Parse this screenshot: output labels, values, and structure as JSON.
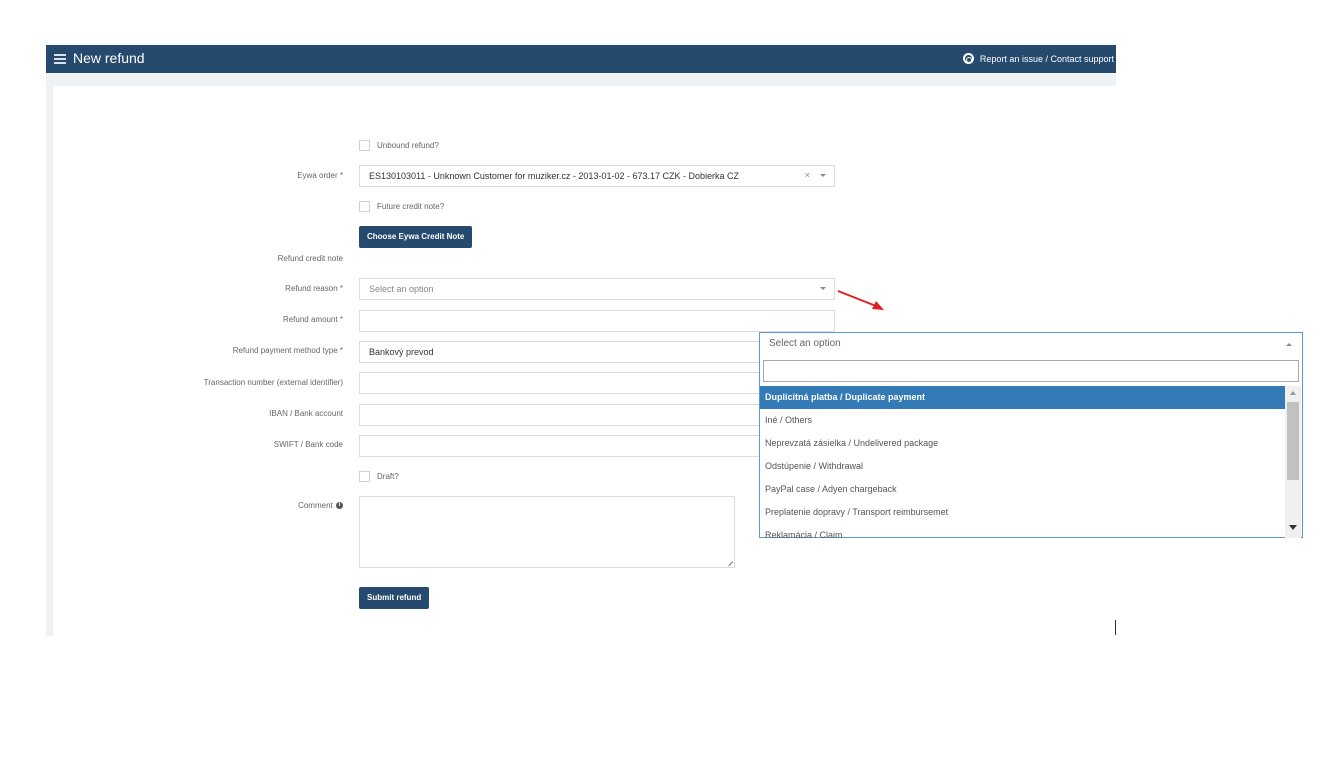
{
  "header": {
    "title": "New refund",
    "support_label": "Report an issue / Contact support"
  },
  "form": {
    "unbound_label": "Unbound refund?",
    "order_label": "Eywa order *",
    "order_value": "ES130103011 - Unknown Customer for muziker.cz - 2013-01-02 - 673.17 CZK - Dobierka CZ",
    "order_clear": "×",
    "future_credit_label": "Future credit note?",
    "choose_credit_button": "Choose Eywa Credit Note",
    "refund_credit_note_label": "Refund credit note",
    "reason_label": "Refund reason *",
    "reason_placeholder": "Select an option",
    "amount_label": "Refund amount *",
    "amount_value": "",
    "payment_method_label": "Refund payment method type *",
    "payment_method_value": "Bankový prevod",
    "transaction_label": "Transaction number (external identifier)",
    "transaction_value": "",
    "iban_label": "IBAN / Bank account",
    "iban_value": "",
    "swift_label": "SWIFT / Bank code",
    "swift_value": "",
    "draft_label": "Draft?",
    "comment_label": "Comment",
    "comment_value": "",
    "submit_button": "Submit refund"
  },
  "dropdown": {
    "selected_text": "Select an option",
    "search_value": "",
    "options": [
      "Duplicitná platba / Duplicate payment",
      "Iné / Others",
      "Neprevzatá zásielka / Undelivered package",
      "Odstúpenie / Withdrawal",
      "PayPal case / Adyen chargeback",
      "Preplatenie dopravy / Transport reimbursemet",
      "Reklamácia / Claim"
    ],
    "highlighted_index": 0
  },
  "colors": {
    "header_bg": "#254a6d",
    "button_bg": "#254a6d",
    "highlight": "#337ab7",
    "arrow": "#e02020"
  },
  "icons": {
    "menu": "hamburger-icon",
    "support": "lifebuoy-icon",
    "info": "info-icon"
  }
}
